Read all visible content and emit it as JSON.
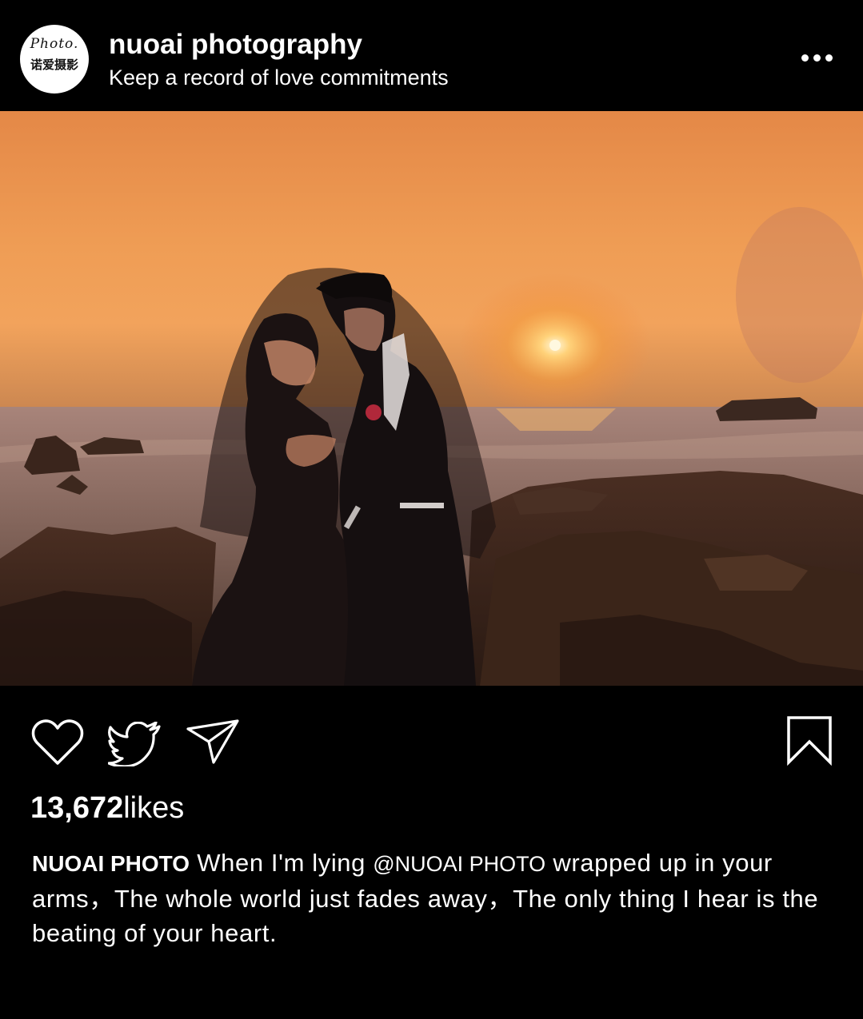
{
  "header": {
    "avatar_script": "Photo.",
    "avatar_chinese": "诺爱摄影",
    "account_name": "nuoai photography",
    "subtitle": "Keep a record of love commitments",
    "more_icon": "more-horizontal-icon"
  },
  "post": {
    "image_icon": "photo",
    "actions": {
      "like_icon": "heart-icon",
      "twitter_icon": "twitter-bird-icon",
      "share_icon": "send-icon",
      "save_icon": "bookmark-icon"
    },
    "likes_count": "13,672",
    "likes_suffix": "likes",
    "caption": {
      "author": "NUOAI PHOTO",
      "text_before_mention": " When I'm lying ",
      "mention": "@NUOAI PHOTO",
      "text_after_mention": " wrapped up in your arms，The whole world just fades away，The only thing I hear is the beating of your heart."
    }
  },
  "colors": {
    "background": "#000000",
    "text": "#ffffff",
    "sky_top": "#e88a45",
    "sky_horizon": "#f0a560",
    "sun": "#fff3c8"
  }
}
